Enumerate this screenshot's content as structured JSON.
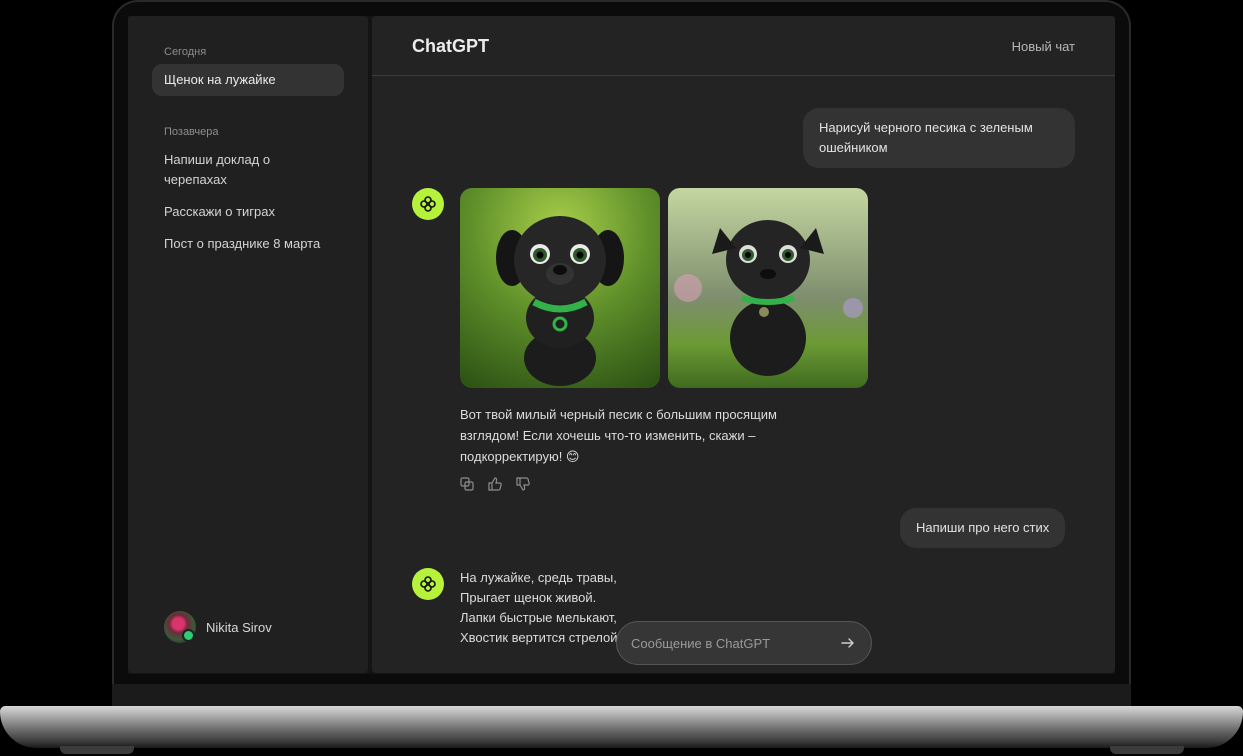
{
  "sidebar": {
    "sections": [
      {
        "label": "Сегодня",
        "items": [
          {
            "label": "Щенок на лужайке",
            "active": true
          }
        ]
      },
      {
        "label": "Позавчера",
        "items": [
          {
            "label": "Напиши доклад о черепахах"
          },
          {
            "label": "Расскажи о тиграх"
          },
          {
            "label": "Пост о празднике 8 марта"
          }
        ]
      }
    ],
    "user": {
      "name": "Nikita Sirov"
    }
  },
  "header": {
    "title": "ChatGPT",
    "new_chat": "Новый чат"
  },
  "messages": {
    "user_1": "Нарисуй черного песика с зеленым ошейником",
    "bot_1": "Вот твой милый черный песик с большим просящим взглядом! Если хочешь что-то изменить, скажи – подкорректирую! 😊",
    "user_2": "Напиши про него стих",
    "bot_2": [
      "На лужайке, средь травы,",
      "Прыгает щенок живой.",
      "Лапки быстрые мелькают,",
      "Хвостик вертится стрелой"
    ]
  },
  "composer": {
    "placeholder": "Сообщение в ChatGPT"
  },
  "colors": {
    "accent": "#b6f23c",
    "bubble": "#333333",
    "panel": "#232323",
    "sidebar": "#202020"
  },
  "icons": [
    "copy-icon",
    "thumbs-up-icon",
    "thumbs-down-icon",
    "send-arrow-icon",
    "chatgpt-logo-icon"
  ]
}
